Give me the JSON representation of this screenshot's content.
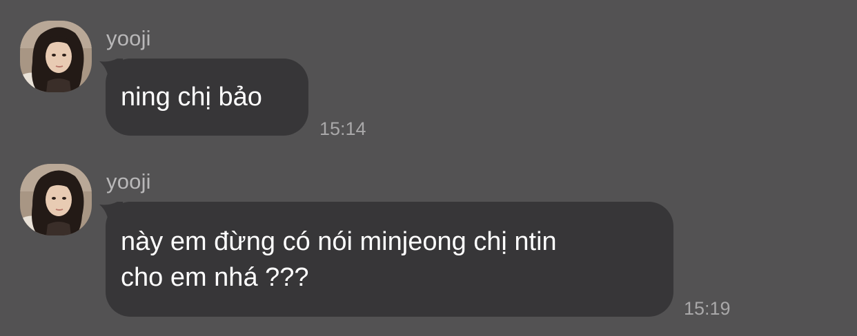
{
  "colors": {
    "background": "#535253",
    "bubble": "#373638",
    "message_text": "#ffffff",
    "sender_text": "#b9b8b9",
    "timestamp_text": "#a9a8a9"
  },
  "messages": [
    {
      "sender": "yooji",
      "avatar": "avatar-photo",
      "text": "ning chị bảo",
      "time": "15:14"
    },
    {
      "sender": "yooji",
      "avatar": "avatar-photo",
      "text": "này em đừng có nói minjeong chị ntin\ncho em nhá ???",
      "time": "15:19"
    }
  ]
}
